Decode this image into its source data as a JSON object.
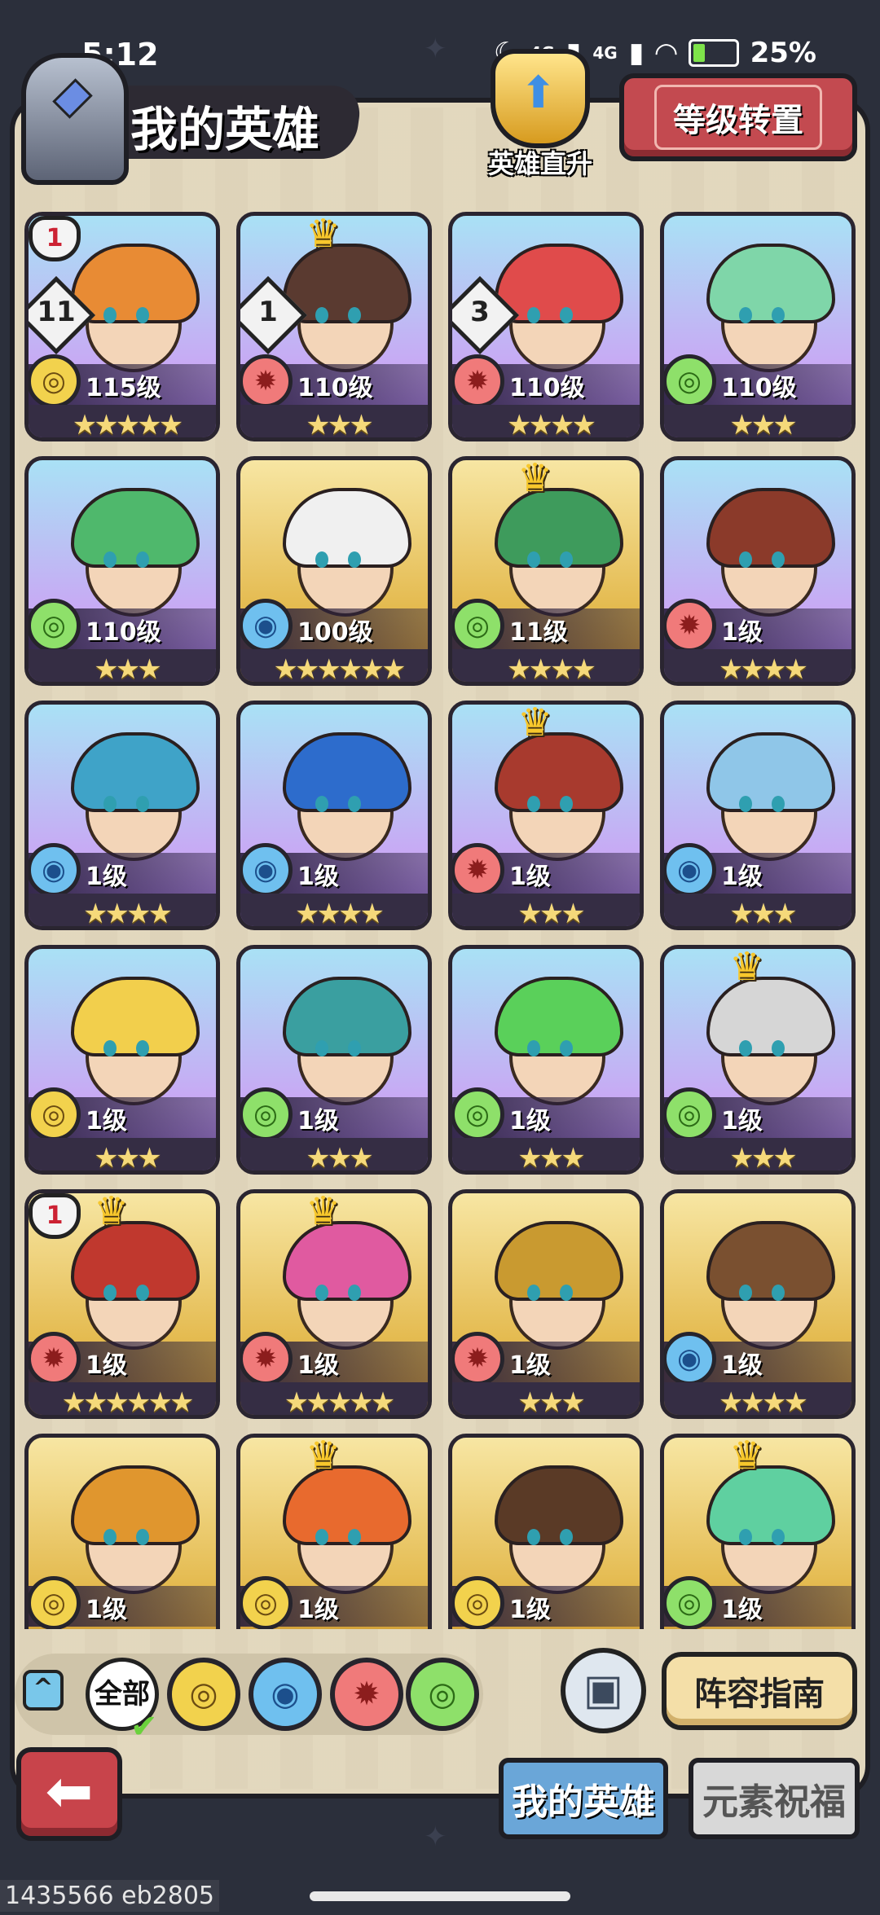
{
  "status": {
    "time": "5:12",
    "signal1": "4G",
    "signal2": "4G",
    "battery": "25%"
  },
  "header": {
    "title": "我的英雄",
    "direct_up": "英雄直升",
    "level_reset": "等级转置"
  },
  "heroes": [
    {
      "level": "115级",
      "element": "earth",
      "stars": "★★★★★",
      "frame": "purple",
      "badge": "11",
      "shield": "1",
      "crown": false,
      "hair": "#e88b34"
    },
    {
      "level": "110级",
      "element": "fire",
      "stars": "★★★",
      "frame": "purple",
      "badge": "1",
      "crown": true,
      "hair": "#5a3a30"
    },
    {
      "level": "110级",
      "element": "fire",
      "stars": "★★★★",
      "frame": "purple",
      "badge": "3",
      "crown": false,
      "hair": "#e04b4b"
    },
    {
      "level": "110级",
      "element": "wind",
      "stars": "★★★",
      "frame": "purple",
      "crown": false,
      "hair": "#7fd6a9"
    },
    {
      "level": "110级",
      "element": "wind",
      "stars": "★★★",
      "frame": "purple",
      "crown": false,
      "hair": "#4fb86c"
    },
    {
      "level": "100级",
      "element": "water",
      "stars": "★★★★★★",
      "frame": "gold",
      "crown": false,
      "hair": "#f0f0f0"
    },
    {
      "level": "11级",
      "element": "wind",
      "stars": "★★★★",
      "frame": "gold",
      "crown": true,
      "hair": "#3e9b5c"
    },
    {
      "level": "1级",
      "element": "fire",
      "stars": "★★★★",
      "frame": "purple",
      "crown": false,
      "hair": "#8b3a2a"
    },
    {
      "level": "1级",
      "element": "water",
      "stars": "★★★★",
      "frame": "purple",
      "crown": false,
      "hair": "#3fa3c8"
    },
    {
      "level": "1级",
      "element": "water",
      "stars": "★★★★",
      "frame": "purple",
      "crown": false,
      "hair": "#2d6ccc"
    },
    {
      "level": "1级",
      "element": "fire",
      "stars": "★★★",
      "frame": "purple",
      "crown": true,
      "hair": "#a83a2e"
    },
    {
      "level": "1级",
      "element": "water",
      "stars": "★★★",
      "frame": "purple",
      "crown": false,
      "hair": "#8fc6e8"
    },
    {
      "level": "1级",
      "element": "earth",
      "stars": "★★★",
      "frame": "purple",
      "crown": false,
      "hair": "#f2cf4c"
    },
    {
      "level": "1级",
      "element": "wind",
      "stars": "★★★",
      "frame": "purple",
      "crown": false,
      "hair": "#3a9fa0"
    },
    {
      "level": "1级",
      "element": "wind",
      "stars": "★★★",
      "frame": "purple",
      "crown": false,
      "hair": "#5ad05a"
    },
    {
      "level": "1级",
      "element": "wind",
      "stars": "★★★",
      "frame": "purple",
      "crown": true,
      "hair": "#d6d6d6"
    },
    {
      "level": "1级",
      "element": "fire",
      "stars": "★★★★★★",
      "frame": "gold",
      "crown": true,
      "shield": "1",
      "hair": "#c0382e"
    },
    {
      "level": "1级",
      "element": "fire",
      "stars": "★★★★★",
      "frame": "gold",
      "crown": true,
      "hair": "#e05aa0"
    },
    {
      "level": "1级",
      "element": "fire",
      "stars": "★★★",
      "frame": "gold",
      "crown": false,
      "hair": "#c99a30"
    },
    {
      "level": "1级",
      "element": "water",
      "stars": "★★★★",
      "frame": "gold",
      "crown": false,
      "hair": "#7a5030"
    },
    {
      "level": "1级",
      "element": "earth",
      "stars": "",
      "frame": "gold",
      "crown": false,
      "hair": "#e0962e"
    },
    {
      "level": "1级",
      "element": "earth",
      "stars": "",
      "frame": "gold",
      "crown": true,
      "hair": "#e86a2e"
    },
    {
      "level": "1级",
      "element": "earth",
      "stars": "",
      "frame": "gold",
      "crown": false,
      "hair": "#5a3a26"
    },
    {
      "level": "1级",
      "element": "wind",
      "stars": "",
      "frame": "gold",
      "crown": true,
      "hair": "#5fd0a0"
    }
  ],
  "filter": {
    "all_label": "全部",
    "elements": [
      "earth",
      "water",
      "fire",
      "wind"
    ]
  },
  "actions": {
    "guide": "阵容指南"
  },
  "tabs": {
    "my_heroes": "我的英雄",
    "element_blessing": "元素祝福"
  },
  "footer": {
    "code": "1435566 eb2805"
  },
  "colors": {
    "panel": "#e2d7bd",
    "accent_red": "#c34a50",
    "tab_active": "#6aa6d8"
  }
}
